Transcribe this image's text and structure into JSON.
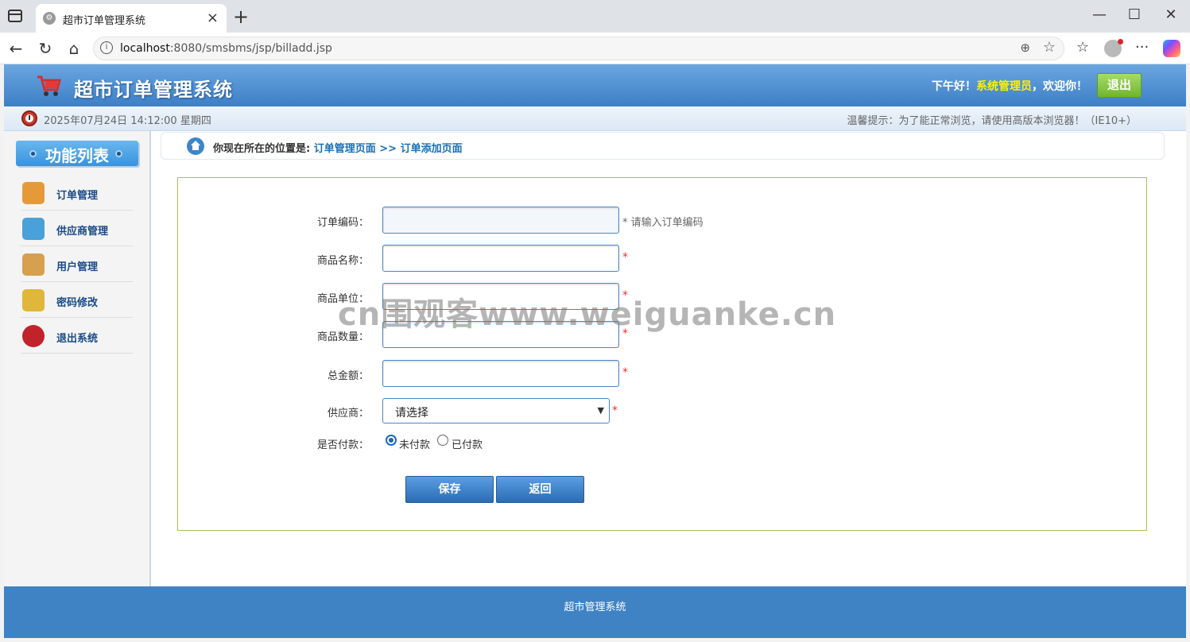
{
  "browser": {
    "tab_title": "超市订单管理系统",
    "favicon_glyph": "⚙",
    "url_host": "localhost",
    "url_rest": ":8080/smsbms/jsp/billadd.jsp"
  },
  "header": {
    "system_title": "超市订单管理系统",
    "greeting_prefix": "下午好！",
    "user_name": "系统管理员",
    "greeting_suffix": "，欢迎你！",
    "logout_label": "退出"
  },
  "infobar": {
    "datetime": "2025年07月24日 14:12:00 星期四",
    "tip": "温馨提示：为了能正常浏览，请使用高版本浏览器！（IE10+）"
  },
  "sidebar": {
    "title": "功能列表",
    "items": [
      {
        "label": "订单管理",
        "icon": "order-icon",
        "color": "#e59a3a"
      },
      {
        "label": "供应商管理",
        "icon": "supplier-icon",
        "color": "#4aa0d8"
      },
      {
        "label": "用户管理",
        "icon": "users-icon",
        "color": "#d7a04f"
      },
      {
        "label": "密码修改",
        "icon": "password-icon",
        "color": "#e0b63b"
      },
      {
        "label": "退出系统",
        "icon": "exit-icon",
        "color": "#c0242a"
      }
    ]
  },
  "breadcrumb": {
    "prefix": "你现在所在的位置是:",
    "path": "订单管理页面 >> 订单添加页面"
  },
  "form": {
    "code_label": "订单编码：",
    "code_hint": "* 请输入订单编码",
    "name_label": "商品名称：",
    "unit_label": "商品单位：",
    "count_label": "商品数量：",
    "total_label": "总金额：",
    "supplier_label": "供应商：",
    "supplier_value": "请选择",
    "paid_label": "是否付款：",
    "unpaid_option": "未付款",
    "paid_option": "已付款",
    "required_mark": "*",
    "save_label": "保存",
    "back_label": "返回"
  },
  "watermark": "cn围观客www.weiguanke.cn",
  "footer": {
    "text": "超市管理系统"
  }
}
